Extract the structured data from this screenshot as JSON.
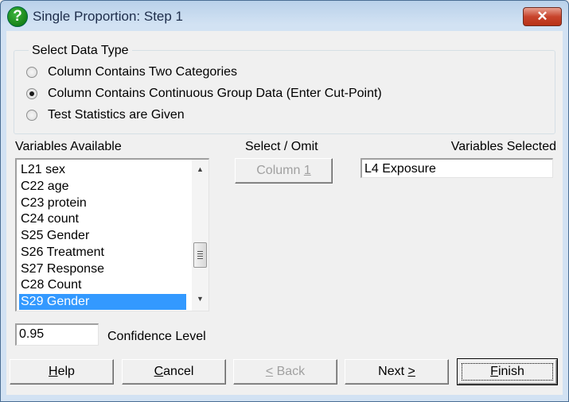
{
  "window": {
    "title": "Single Proportion: Step 1",
    "title_icon": "help-question-icon",
    "close_glyph": "✕"
  },
  "data_type_group": {
    "title": "Select Data Type",
    "options": [
      {
        "label": "Column Contains Two Categories",
        "checked": false
      },
      {
        "label": "Column Contains Continuous Group Data (Enter Cut-Point)",
        "checked": true
      },
      {
        "label": "Test Statistics are Given",
        "checked": false
      }
    ]
  },
  "variables_available": {
    "label": "Variables Available",
    "items": [
      "L21 sex",
      "C22 age",
      "C23 protein",
      "C24 count",
      "S25 Gender",
      "S26 Treatment",
      "S27 Response",
      "C28 Count",
      "S29 Gender"
    ],
    "selected_index": 8
  },
  "select_omit": {
    "label": "Select / Omit",
    "button_text": "Column ",
    "button_accel": "1"
  },
  "variables_selected": {
    "label": "Variables Selected",
    "value": "L4 Exposure"
  },
  "confidence": {
    "value": "0.95",
    "label": "Confidence Level"
  },
  "buttons": {
    "help": {
      "accel": "H",
      "rest": "elp"
    },
    "cancel": {
      "accel": "C",
      "rest": "ancel"
    },
    "back": {
      "accel": "<",
      "rest": " Back"
    },
    "next": {
      "text": "Next ",
      "accel": ">"
    },
    "finish": {
      "accel": "F",
      "rest": "inish"
    }
  }
}
